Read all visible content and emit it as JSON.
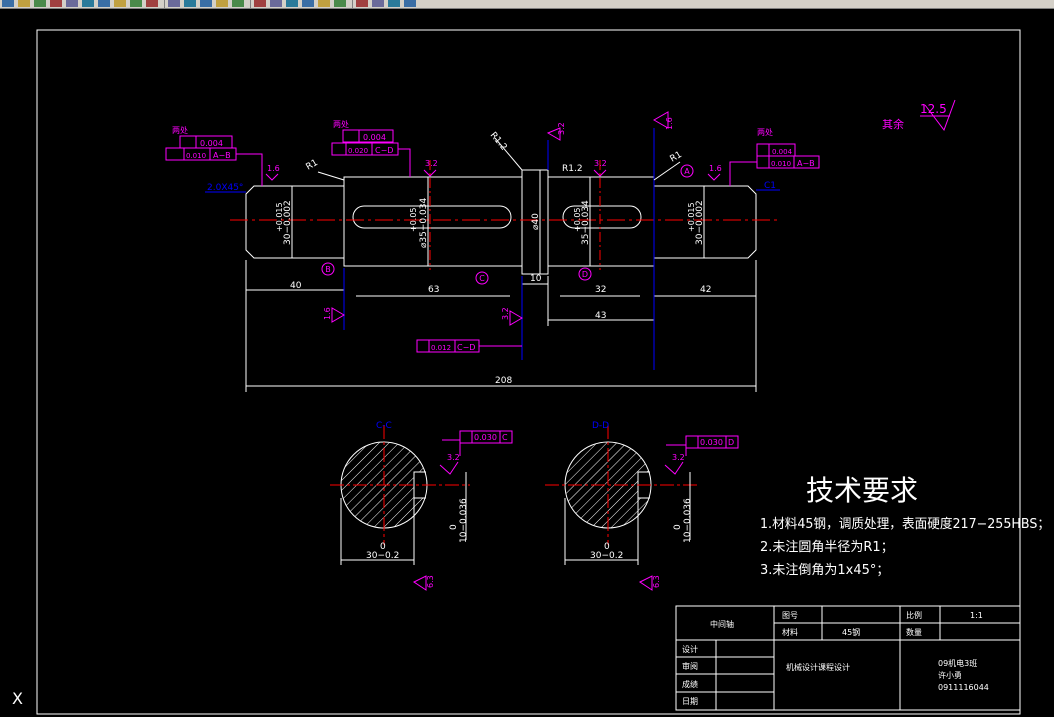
{
  "toolbar": {
    "icons": [
      "back-icon",
      "print-icon",
      "open-icon",
      "save-icon",
      "cut-icon",
      "copy-icon",
      "paste-icon",
      "match-icon",
      "undo-icon",
      "redo-icon",
      "pan-icon",
      "zoom-icon",
      "zoom-window-icon",
      "zoom-previous-icon",
      "properties-icon",
      "design-center-icon",
      "tool-palette-icon",
      "sheet-set-icon",
      "markup-icon",
      "calc-icon",
      "help-icon",
      "layer-icon",
      "layer-prev-icon",
      "layer-state-icon",
      "color-icon"
    ]
  },
  "drawing": {
    "colors": {
      "white": "#ffffff",
      "magenta": "#ff00ff",
      "red": "#ff0000",
      "blue": "#0000ff",
      "yellow": "#ffff00",
      "cyan": "#00ffff"
    },
    "surface_finish": {
      "general_value": "12.5",
      "general_label": "其余",
      "v32": "3.2",
      "v16": "1.6",
      "v63": "6.3"
    },
    "annotations": {
      "liangchu": "两处",
      "r1": "R1",
      "r12": "R1.2",
      "chamfer": "2.0X45°",
      "c1": "C1",
      "phi40": "⌀40",
      "dim40": "40",
      "dim63": "63",
      "dim10": "10",
      "dim32": "32",
      "dim43": "43",
      "dim42": "42",
      "dim208": "208",
      "d30a": "30−0.002",
      "d30a_tol": "+0.015",
      "d35": "⌀35−0.034",
      "d35_tol": "+0.05",
      "d30b": "30−0.002",
      "d30b_tol": "+0.015",
      "d35b": "35−0.034",
      "d35b_tol": "+0.05",
      "datum_a": "A",
      "datum_b": "B",
      "datum_c": "C",
      "datum_d": "D",
      "fcf1_tol": "0.004",
      "fcf1b_tol": "0.010",
      "fcf1b_ref": "A−B",
      "fcf2_tol": "0.004",
      "fcf2b_tol": "0.020",
      "fcf2b_ref": "C−D",
      "fcf3_tol": "0.004",
      "fcf3b_tol": "0.010",
      "fcf3b_ref": "A−B",
      "fcf4_tol": "0.012",
      "fcf4_ref": "C−D",
      "section_cc": "C-C",
      "section_dd": "D-D",
      "sec_c_tol": "0.030",
      "sec_c_ref": "C",
      "sec_d_tol": "0.030",
      "sec_d_ref": "D",
      "sec_width": "30−0.2",
      "sec_width_tol": "0",
      "sec_depth": "10−0.036",
      "sec_depth_tol": "0"
    },
    "tech_requirements": {
      "title": "技术要求",
      "items": [
        "1.材料45钢，调质处理，表面硬度217−255HBS；",
        "2.未注圆角半径为R1；",
        "3.未注倒角为1x45°；"
      ]
    },
    "title_block": {
      "part_name": "中间轴",
      "drawing_no_label": "图号",
      "scale_label": "比例",
      "scale_value": "1:1",
      "material_label": "材料",
      "material_value": "45钢",
      "qty_label": "数量",
      "design_label": "设计",
      "review_label": "审阅",
      "grade_label": "成绩",
      "date_label": "日期",
      "course": "机械设计课程设计",
      "class": "09机电3班",
      "student": "许小勇",
      "student_id": "0911116044"
    },
    "ucs_label": "X"
  }
}
